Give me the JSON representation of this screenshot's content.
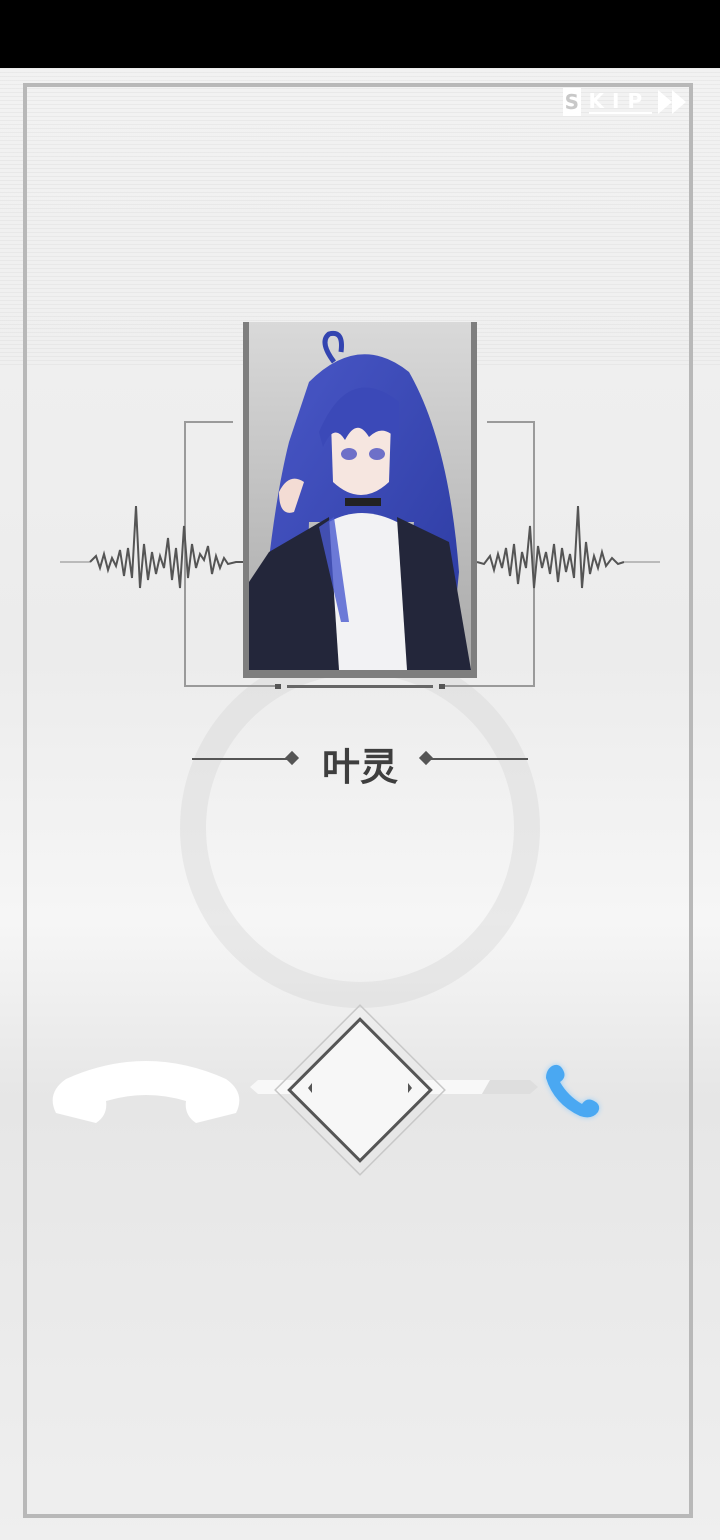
{
  "skip": {
    "first_letter": "S",
    "rest_label": "KIP"
  },
  "caller": {
    "name": "叶灵"
  },
  "colors": {
    "accent_answer": "#4aa8f2",
    "frame": "#b8b8b8",
    "name_text": "#3e3e3e"
  },
  "icons": {
    "skip": "fast-forward-icon",
    "hangup": "hang-up-phone-icon",
    "answer": "phone-icon",
    "dial": "diamond-slider-icon"
  }
}
